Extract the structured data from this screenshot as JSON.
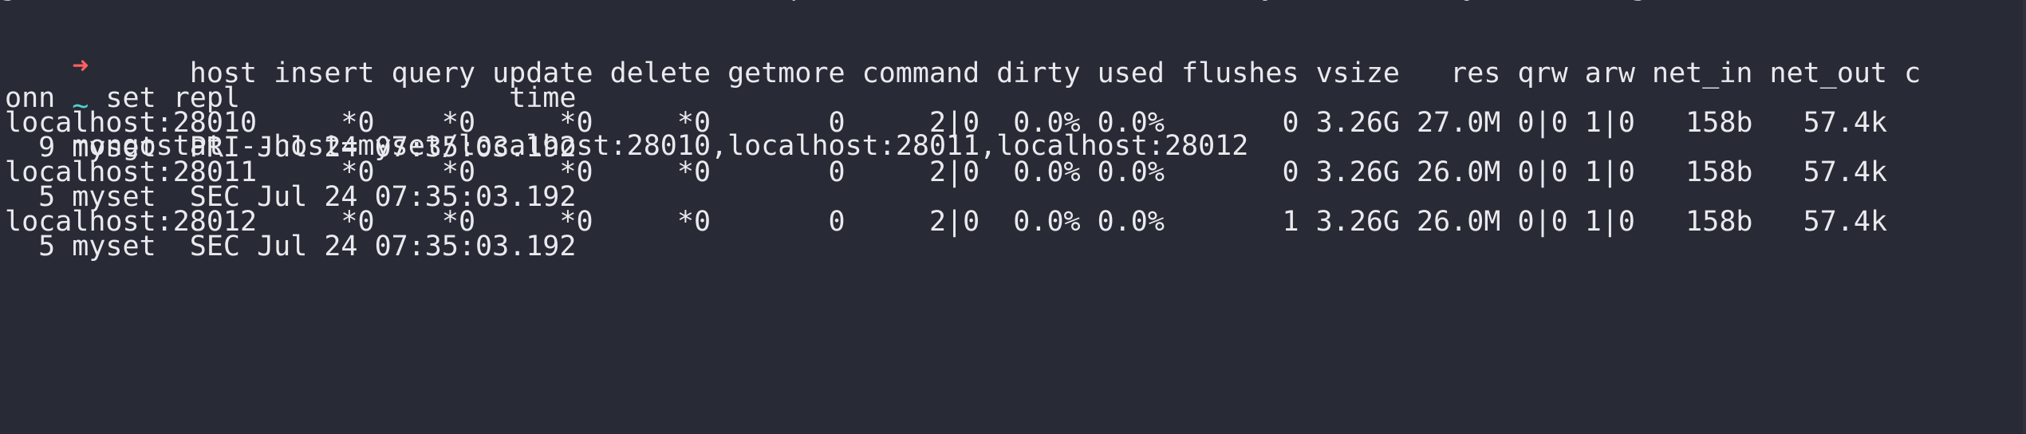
{
  "terminal": {
    "clipped_top": "g                                              p                           y           y         g",
    "prompt": {
      "arrow": "➜",
      "dir": "~",
      "command": "mongostat --host=myset/localhost:28010,localhost:28011,localhost:28012"
    },
    "header": {
      "line1": "           host insert query update delete getmore command dirty used flushes vsize   res qrw arw net_in net_out c",
      "line2": "onn   set repl                time"
    },
    "rows": [
      {
        "line1": "localhost:28010     *0    *0     *0     *0       0     2|0  0.0% 0.0%       0 3.26G 27.0M 0|0 1|0   158b   57.4k",
        "line2": "  9 myset  PRI Jul 24 07:35:03.192"
      },
      {
        "line1": "localhost:28011     *0    *0     *0     *0       0     2|0  0.0% 0.0%       0 3.26G 26.0M 0|0 1|0   158b   57.4k",
        "line2": "  5 myset  SEC Jul 24 07:35:03.192"
      },
      {
        "line1": "localhost:28012     *0    *0     *0     *0       0     2|0  0.0% 0.0%       1 3.26G 26.0M 0|0 1|0   158b   57.4k",
        "line2": "  5 myset  SEC Jul 24 07:35:03.192"
      }
    ]
  },
  "colors": {
    "background": "#282a35",
    "text": "#e9eaee",
    "prompt_arrow": "#ff5f5f",
    "prompt_dir": "#4fd2d2"
  }
}
